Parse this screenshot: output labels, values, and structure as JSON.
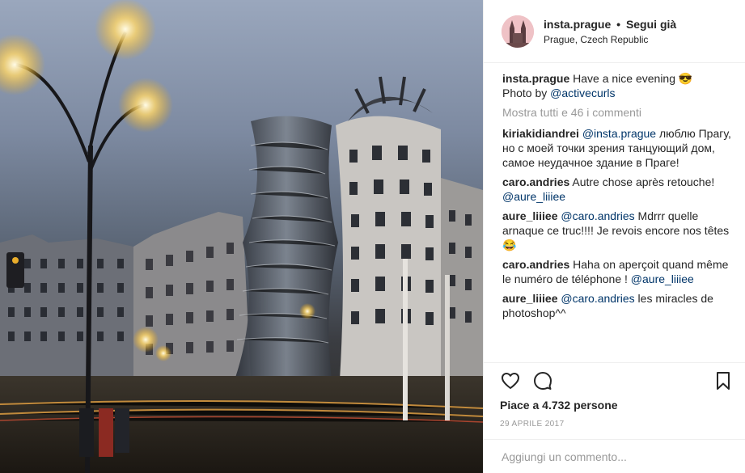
{
  "post": {
    "username": "insta.prague",
    "separator": "•",
    "follow_label": "Segui già",
    "location": "Prague, Czech Republic"
  },
  "caption": {
    "username": "insta.prague",
    "text": "Have a nice evening 😎",
    "line2_prefix": "Photo by ",
    "line2_mention": "@activecurls"
  },
  "view_all_comments": "Mostra tutti e 46 i commenti",
  "comments": [
    {
      "user": "kiriakidiandrei",
      "mention": "@insta.prague",
      "text": " люблю Прагу, но с моей точки зрения танцующий дом, самое неудачное здание в Праге!"
    },
    {
      "user": "caro.andries",
      "mention": "",
      "text": " Autre chose après retouche! ",
      "trail_mention": "@aure_liiiee"
    },
    {
      "user": "aure_liiiee",
      "mention": "@caro.andries",
      "text": " Mdrrr quelle arnaque ce truc!!!! Je revois encore nos têtes 😂"
    },
    {
      "user": "caro.andries",
      "mention": "",
      "text": " Haha on aperçoit quand même le numéro de téléphone ! ",
      "trail_mention": "@aure_liiiee"
    },
    {
      "user": "aure_liiiee",
      "mention": "@caro.andries",
      "text": " les miracles de photoshop^^"
    }
  ],
  "icons": {
    "like": "heart-icon",
    "comment": "comment-icon",
    "save": "bookmark-icon"
  },
  "likes_text": "Piace a 4.732 persone",
  "date": "29 APRILE 2017",
  "add_comment_placeholder": "Aggiungi un commento..."
}
